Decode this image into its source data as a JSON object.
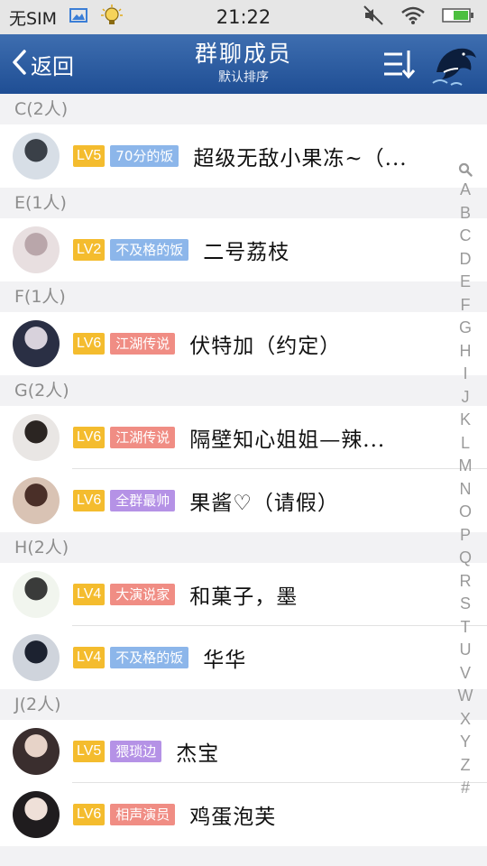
{
  "status_bar": {
    "carrier": "无SIM",
    "time": "21:22"
  },
  "header": {
    "back_label": "返回",
    "title": "群聊成员",
    "subtitle": "默认排序"
  },
  "colors": {
    "header": "#2a5aa0",
    "lv": "#f4bc2e",
    "tag_blue": "#8cb6ea",
    "tag_red": "#f08d84",
    "tag_purple": "#b592e6"
  },
  "sections": [
    {
      "label": "C(2人)",
      "members": [
        {
          "level": "LV5",
          "tag": "70分的饭",
          "tag_color": "#8cb6ea",
          "name": "超级无敌小果冻~（...",
          "avatar": [
            "#d7dee6",
            "#3a4048"
          ]
        }
      ]
    },
    {
      "label": "E(1人)",
      "members": [
        {
          "level": "LV2",
          "tag": "不及格的饭",
          "tag_color": "#8cb6ea",
          "name": "二号荔枝",
          "avatar": [
            "#e8dfe0",
            "#b9a6aa"
          ]
        }
      ]
    },
    {
      "label": "F(1人)",
      "members": [
        {
          "level": "LV6",
          "tag": "江湖传说",
          "tag_color": "#f08d84",
          "name": "伏特加（约定）",
          "avatar": [
            "#2a2f44",
            "#d8d2dc"
          ]
        }
      ]
    },
    {
      "label": "G(2人)",
      "members": [
        {
          "level": "LV6",
          "tag": "江湖传说",
          "tag_color": "#f08d84",
          "name": "隔壁知心姐姐—辣...",
          "avatar": [
            "#e9e6e4",
            "#2b2522"
          ]
        },
        {
          "level": "LV6",
          "tag": "全群最帅",
          "tag_color": "#b592e6",
          "name": "果酱♡（请假）",
          "avatar": [
            "#d9c3b4",
            "#4a2f28"
          ]
        }
      ]
    },
    {
      "label": "H(2人)",
      "members": [
        {
          "level": "LV4",
          "tag": "大演说家",
          "tag_color": "#f08d84",
          "name": "和菓子，墨",
          "avatar": [
            "#f1f5ee",
            "#3a3b3a"
          ]
        },
        {
          "level": "LV4",
          "tag": "不及格的饭",
          "tag_color": "#8cb6ea",
          "name": "华华",
          "avatar": [
            "#cfd4dc",
            "#1c2230"
          ]
        }
      ]
    },
    {
      "label": "J(2人)",
      "members": [
        {
          "level": "LV5",
          "tag": "猥琐边",
          "tag_color": "#b592e6",
          "name": "杰宝",
          "avatar": [
            "#3a2e2e",
            "#e7d3c8"
          ]
        },
        {
          "level": "LV6",
          "tag": "相声演员",
          "tag_color": "#f08d84",
          "name": "鸡蛋泡芙",
          "avatar": [
            "#1f1c1e",
            "#efe0d8"
          ]
        }
      ]
    }
  ],
  "index_letters": [
    "A",
    "B",
    "C",
    "D",
    "E",
    "F",
    "G",
    "H",
    "I",
    "J",
    "K",
    "L",
    "M",
    "N",
    "O",
    "P",
    "Q",
    "R",
    "S",
    "T",
    "U",
    "V",
    "W",
    "X",
    "Y",
    "Z",
    "#"
  ],
  "icons": {
    "back": "chevron-left-icon",
    "sort": "sort-icon",
    "profile": "dolphin-icon",
    "index_search": "search-icon"
  }
}
